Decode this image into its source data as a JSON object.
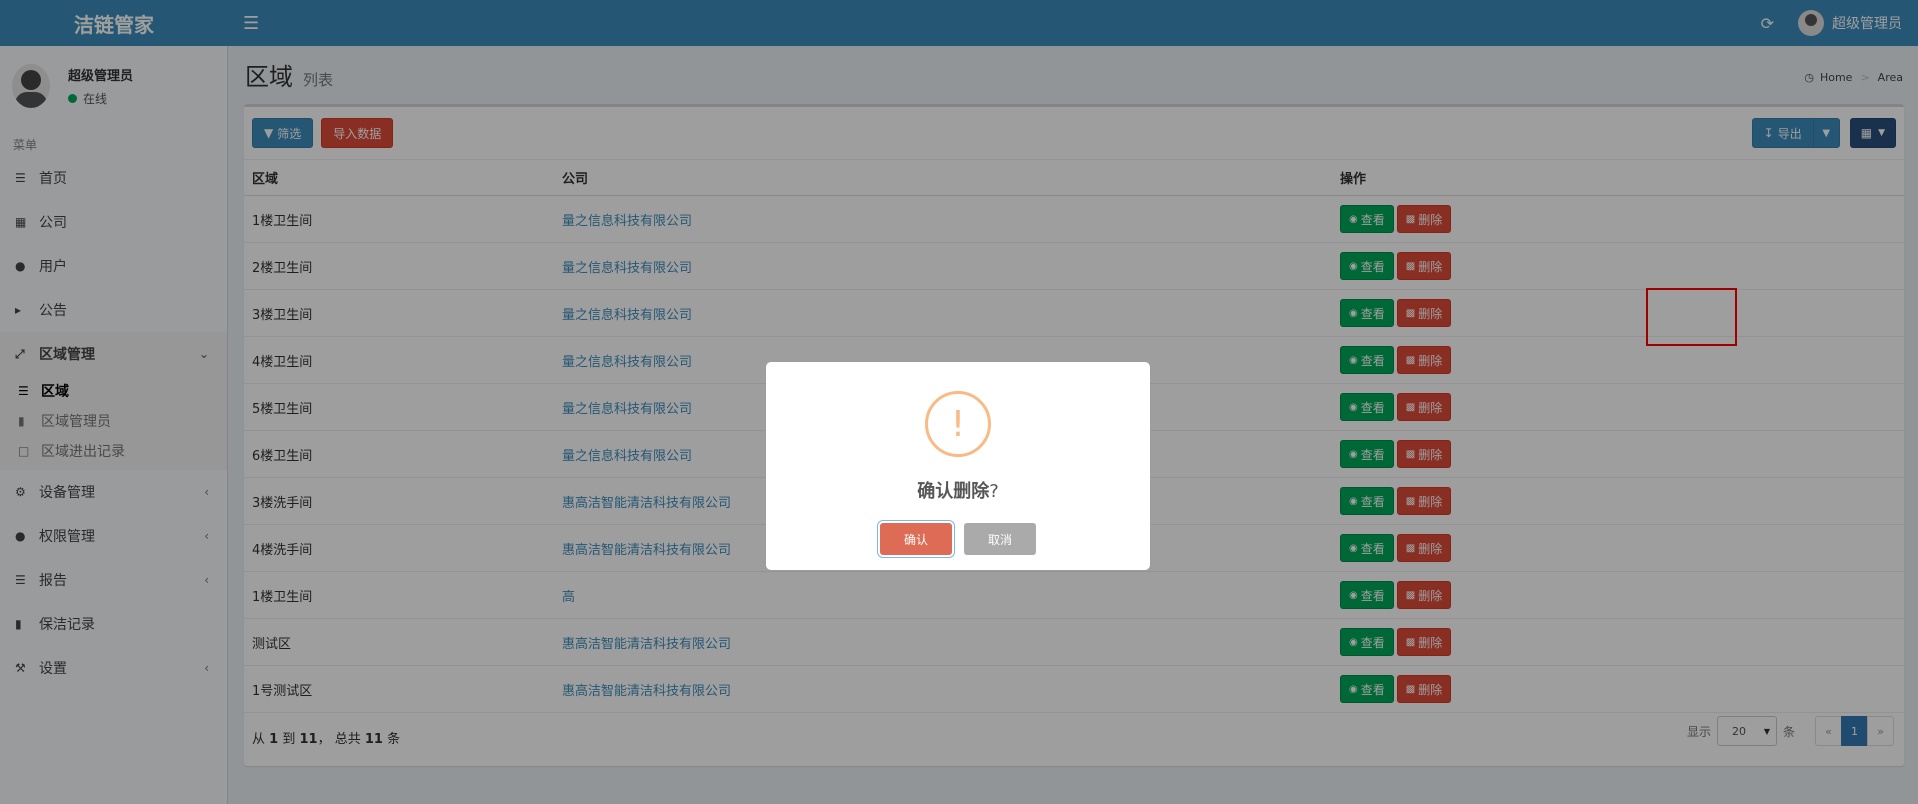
{
  "header": {
    "brand": "洁链管家",
    "username": "超级管理员"
  },
  "sidebar": {
    "user_name": "超级管理员",
    "user_status": "在线",
    "menu_header": "菜单",
    "items": [
      {
        "label": "首页",
        "icon": "list-icon"
      },
      {
        "label": "公司",
        "icon": "building-icon"
      },
      {
        "label": "用户",
        "icon": "user-icon"
      },
      {
        "label": "公告",
        "icon": "megaphone-icon"
      },
      {
        "label": "区域管理",
        "icon": "expand-icon"
      },
      {
        "label": "设备管理",
        "icon": "gears-icon"
      },
      {
        "label": "权限管理",
        "icon": "group-icon"
      },
      {
        "label": "报告",
        "icon": "list-icon"
      },
      {
        "label": "保洁记录",
        "icon": "book-icon"
      },
      {
        "label": "设置",
        "icon": "wrench-icon"
      }
    ],
    "subitems": [
      {
        "label": "区域"
      },
      {
        "label": "区域管理员"
      },
      {
        "label": "区域进出记录"
      }
    ]
  },
  "page": {
    "title": "区域",
    "subtitle": "列表",
    "breadcrumb_home": "Home",
    "breadcrumb_current": "Area"
  },
  "toolbar": {
    "filter_label": "筛选",
    "import_label": "导入数据",
    "export_label": "导出"
  },
  "table": {
    "headers": [
      "区域",
      "公司",
      "操作"
    ],
    "view_label": "查看",
    "delete_label": "删除",
    "rows": [
      {
        "area": "1楼卫生间",
        "company": "量之信息科技有限公司"
      },
      {
        "area": "2楼卫生间",
        "company": "量之信息科技有限公司"
      },
      {
        "area": "3楼卫生间",
        "company": "量之信息科技有限公司"
      },
      {
        "area": "4楼卫生间",
        "company": "量之信息科技有限公司"
      },
      {
        "area": "5楼卫生间",
        "company": "量之信息科技有限公司"
      },
      {
        "area": "6楼卫生间",
        "company": "量之信息科技有限公司"
      },
      {
        "area": "3楼洗手间",
        "company": "惠高洁智能清洁科技有限公司"
      },
      {
        "area": "4楼洗手间",
        "company": "惠高洁智能清洁科技有限公司"
      },
      {
        "area": "1楼卫生间",
        "company": "高"
      },
      {
        "area": "测试区",
        "company": "惠高洁智能清洁科技有限公司"
      },
      {
        "area": "1号测试区",
        "company": "惠高洁智能清洁科技有限公司"
      }
    ]
  },
  "footer": {
    "prefix": "从",
    "from": "1",
    "to_word": "到",
    "to": "11",
    "total_word": "， 总共",
    "total": "11",
    "suffix": "条",
    "show_label": "显示",
    "page_size": "20",
    "unit_label": "条",
    "prev": "«",
    "current_page": "1",
    "next": "»"
  },
  "modal": {
    "title": "确认删除",
    "question_mark": "?",
    "confirm_label": "确认",
    "cancel_label": "取消"
  },
  "colors": {
    "header_bg": "#3c8dbc",
    "view_btn": "#00a65a",
    "delete_btn": "#dd4b39",
    "confirm_btn": "#dd6b55",
    "warning": "#f8bb86"
  }
}
